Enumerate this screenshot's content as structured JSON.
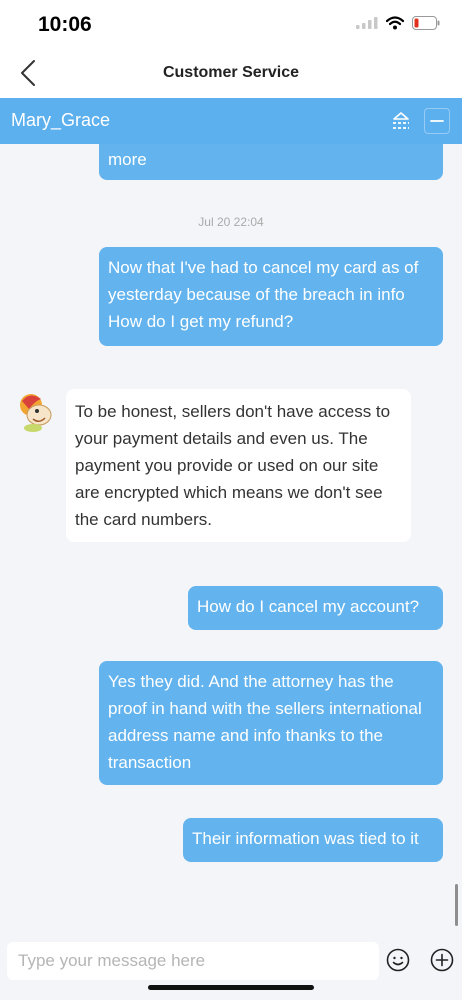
{
  "status": {
    "time": "10:06"
  },
  "nav": {
    "title": "Customer Service"
  },
  "agent": {
    "name": "Mary_Grace"
  },
  "messages": [
    {
      "from": "user",
      "text": "more"
    },
    {
      "from": "system",
      "text": "Jul 20 22:04"
    },
    {
      "from": "user",
      "text": "Now that I've had to cancel my card as of yesterday because of the breach in info How do I get my refund?"
    },
    {
      "from": "agent",
      "text": "To be honest, sellers don't have access to your payment details and even us. The payment you provide or used on our site are encrypted which means we don't see the card numbers."
    },
    {
      "from": "user",
      "text": "How do I cancel my account?"
    },
    {
      "from": "user",
      "text": "Yes they did. And the attorney has the proof in hand with the sellers international address name and info thanks to the transaction"
    },
    {
      "from": "user",
      "text": "Their information was tied to it"
    }
  ],
  "composer": {
    "placeholder": "Type your message here"
  },
  "colors": {
    "accent": "#5cb0ee",
    "bubble_out": "#62b3ee",
    "background": "#f3f5f9"
  },
  "icons": [
    "wifi-icon",
    "battery-icon",
    "signal-icon",
    "back-chevron-icon",
    "queue-icon",
    "minimize-icon",
    "emoji-icon",
    "plus-icon"
  ]
}
